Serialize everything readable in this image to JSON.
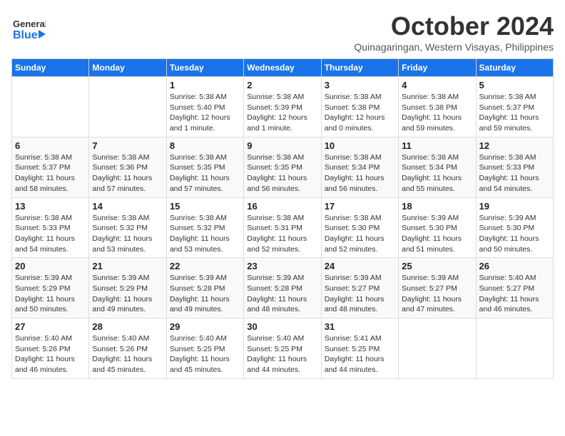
{
  "logo": {
    "line1": "General",
    "line2": "Blue"
  },
  "title": "October 2024",
  "subtitle": "Quinagaringan, Western Visayas, Philippines",
  "days": [
    "Sunday",
    "Monday",
    "Tuesday",
    "Wednesday",
    "Thursday",
    "Friday",
    "Saturday"
  ],
  "weeks": [
    [
      {
        "date": "",
        "info": ""
      },
      {
        "date": "",
        "info": ""
      },
      {
        "date": "1",
        "info": "Sunrise: 5:38 AM\nSunset: 5:40 PM\nDaylight: 12 hours and 1 minute."
      },
      {
        "date": "2",
        "info": "Sunrise: 5:38 AM\nSunset: 5:39 PM\nDaylight: 12 hours and 1 minute."
      },
      {
        "date": "3",
        "info": "Sunrise: 5:38 AM\nSunset: 5:38 PM\nDaylight: 12 hours and 0 minutes."
      },
      {
        "date": "4",
        "info": "Sunrise: 5:38 AM\nSunset: 5:38 PM\nDaylight: 11 hours and 59 minutes."
      },
      {
        "date": "5",
        "info": "Sunrise: 5:38 AM\nSunset: 5:37 PM\nDaylight: 11 hours and 59 minutes."
      }
    ],
    [
      {
        "date": "6",
        "info": "Sunrise: 5:38 AM\nSunset: 5:37 PM\nDaylight: 11 hours and 58 minutes."
      },
      {
        "date": "7",
        "info": "Sunrise: 5:38 AM\nSunset: 5:36 PM\nDaylight: 11 hours and 57 minutes."
      },
      {
        "date": "8",
        "info": "Sunrise: 5:38 AM\nSunset: 5:35 PM\nDaylight: 11 hours and 57 minutes."
      },
      {
        "date": "9",
        "info": "Sunrise: 5:38 AM\nSunset: 5:35 PM\nDaylight: 11 hours and 56 minutes."
      },
      {
        "date": "10",
        "info": "Sunrise: 5:38 AM\nSunset: 5:34 PM\nDaylight: 11 hours and 56 minutes."
      },
      {
        "date": "11",
        "info": "Sunrise: 5:38 AM\nSunset: 5:34 PM\nDaylight: 11 hours and 55 minutes."
      },
      {
        "date": "12",
        "info": "Sunrise: 5:38 AM\nSunset: 5:33 PM\nDaylight: 11 hours and 54 minutes."
      }
    ],
    [
      {
        "date": "13",
        "info": "Sunrise: 5:38 AM\nSunset: 5:33 PM\nDaylight: 11 hours and 54 minutes."
      },
      {
        "date": "14",
        "info": "Sunrise: 5:38 AM\nSunset: 5:32 PM\nDaylight: 11 hours and 53 minutes."
      },
      {
        "date": "15",
        "info": "Sunrise: 5:38 AM\nSunset: 5:32 PM\nDaylight: 11 hours and 53 minutes."
      },
      {
        "date": "16",
        "info": "Sunrise: 5:38 AM\nSunset: 5:31 PM\nDaylight: 11 hours and 52 minutes."
      },
      {
        "date": "17",
        "info": "Sunrise: 5:38 AM\nSunset: 5:30 PM\nDaylight: 11 hours and 52 minutes."
      },
      {
        "date": "18",
        "info": "Sunrise: 5:39 AM\nSunset: 5:30 PM\nDaylight: 11 hours and 51 minutes."
      },
      {
        "date": "19",
        "info": "Sunrise: 5:39 AM\nSunset: 5:30 PM\nDaylight: 11 hours and 50 minutes."
      }
    ],
    [
      {
        "date": "20",
        "info": "Sunrise: 5:39 AM\nSunset: 5:29 PM\nDaylight: 11 hours and 50 minutes."
      },
      {
        "date": "21",
        "info": "Sunrise: 5:39 AM\nSunset: 5:29 PM\nDaylight: 11 hours and 49 minutes."
      },
      {
        "date": "22",
        "info": "Sunrise: 5:39 AM\nSunset: 5:28 PM\nDaylight: 11 hours and 49 minutes."
      },
      {
        "date": "23",
        "info": "Sunrise: 5:39 AM\nSunset: 5:28 PM\nDaylight: 11 hours and 48 minutes."
      },
      {
        "date": "24",
        "info": "Sunrise: 5:39 AM\nSunset: 5:27 PM\nDaylight: 11 hours and 48 minutes."
      },
      {
        "date": "25",
        "info": "Sunrise: 5:39 AM\nSunset: 5:27 PM\nDaylight: 11 hours and 47 minutes."
      },
      {
        "date": "26",
        "info": "Sunrise: 5:40 AM\nSunset: 5:27 PM\nDaylight: 11 hours and 46 minutes."
      }
    ],
    [
      {
        "date": "27",
        "info": "Sunrise: 5:40 AM\nSunset: 5:26 PM\nDaylight: 11 hours and 46 minutes."
      },
      {
        "date": "28",
        "info": "Sunrise: 5:40 AM\nSunset: 5:26 PM\nDaylight: 11 hours and 45 minutes."
      },
      {
        "date": "29",
        "info": "Sunrise: 5:40 AM\nSunset: 5:25 PM\nDaylight: 11 hours and 45 minutes."
      },
      {
        "date": "30",
        "info": "Sunrise: 5:40 AM\nSunset: 5:25 PM\nDaylight: 11 hours and 44 minutes."
      },
      {
        "date": "31",
        "info": "Sunrise: 5:41 AM\nSunset: 5:25 PM\nDaylight: 11 hours and 44 minutes."
      },
      {
        "date": "",
        "info": ""
      },
      {
        "date": "",
        "info": ""
      }
    ]
  ]
}
